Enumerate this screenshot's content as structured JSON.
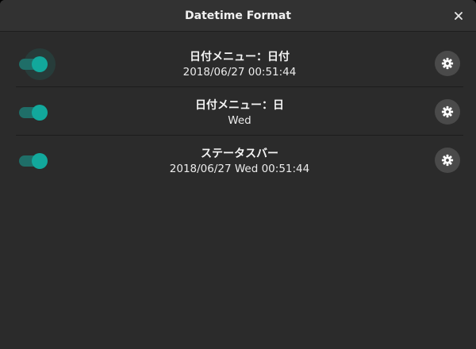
{
  "window": {
    "title": "Datetime Format"
  },
  "colors": {
    "accent": "#12a89c",
    "track": "#1f6e68",
    "background": "#2b2b2b",
    "titlebar": "#323232"
  },
  "icons": {
    "close": "close-icon",
    "settings": "gear-icon"
  },
  "rows": [
    {
      "title": "日付メニュー：日付",
      "value": "2018/06/27 00:51:44",
      "enabled": true
    },
    {
      "title": "日付メニュー：日",
      "value": "Wed",
      "enabled": true
    },
    {
      "title": "ステータスバー",
      "value": "2018/06/27 Wed 00:51:44",
      "enabled": true
    }
  ]
}
